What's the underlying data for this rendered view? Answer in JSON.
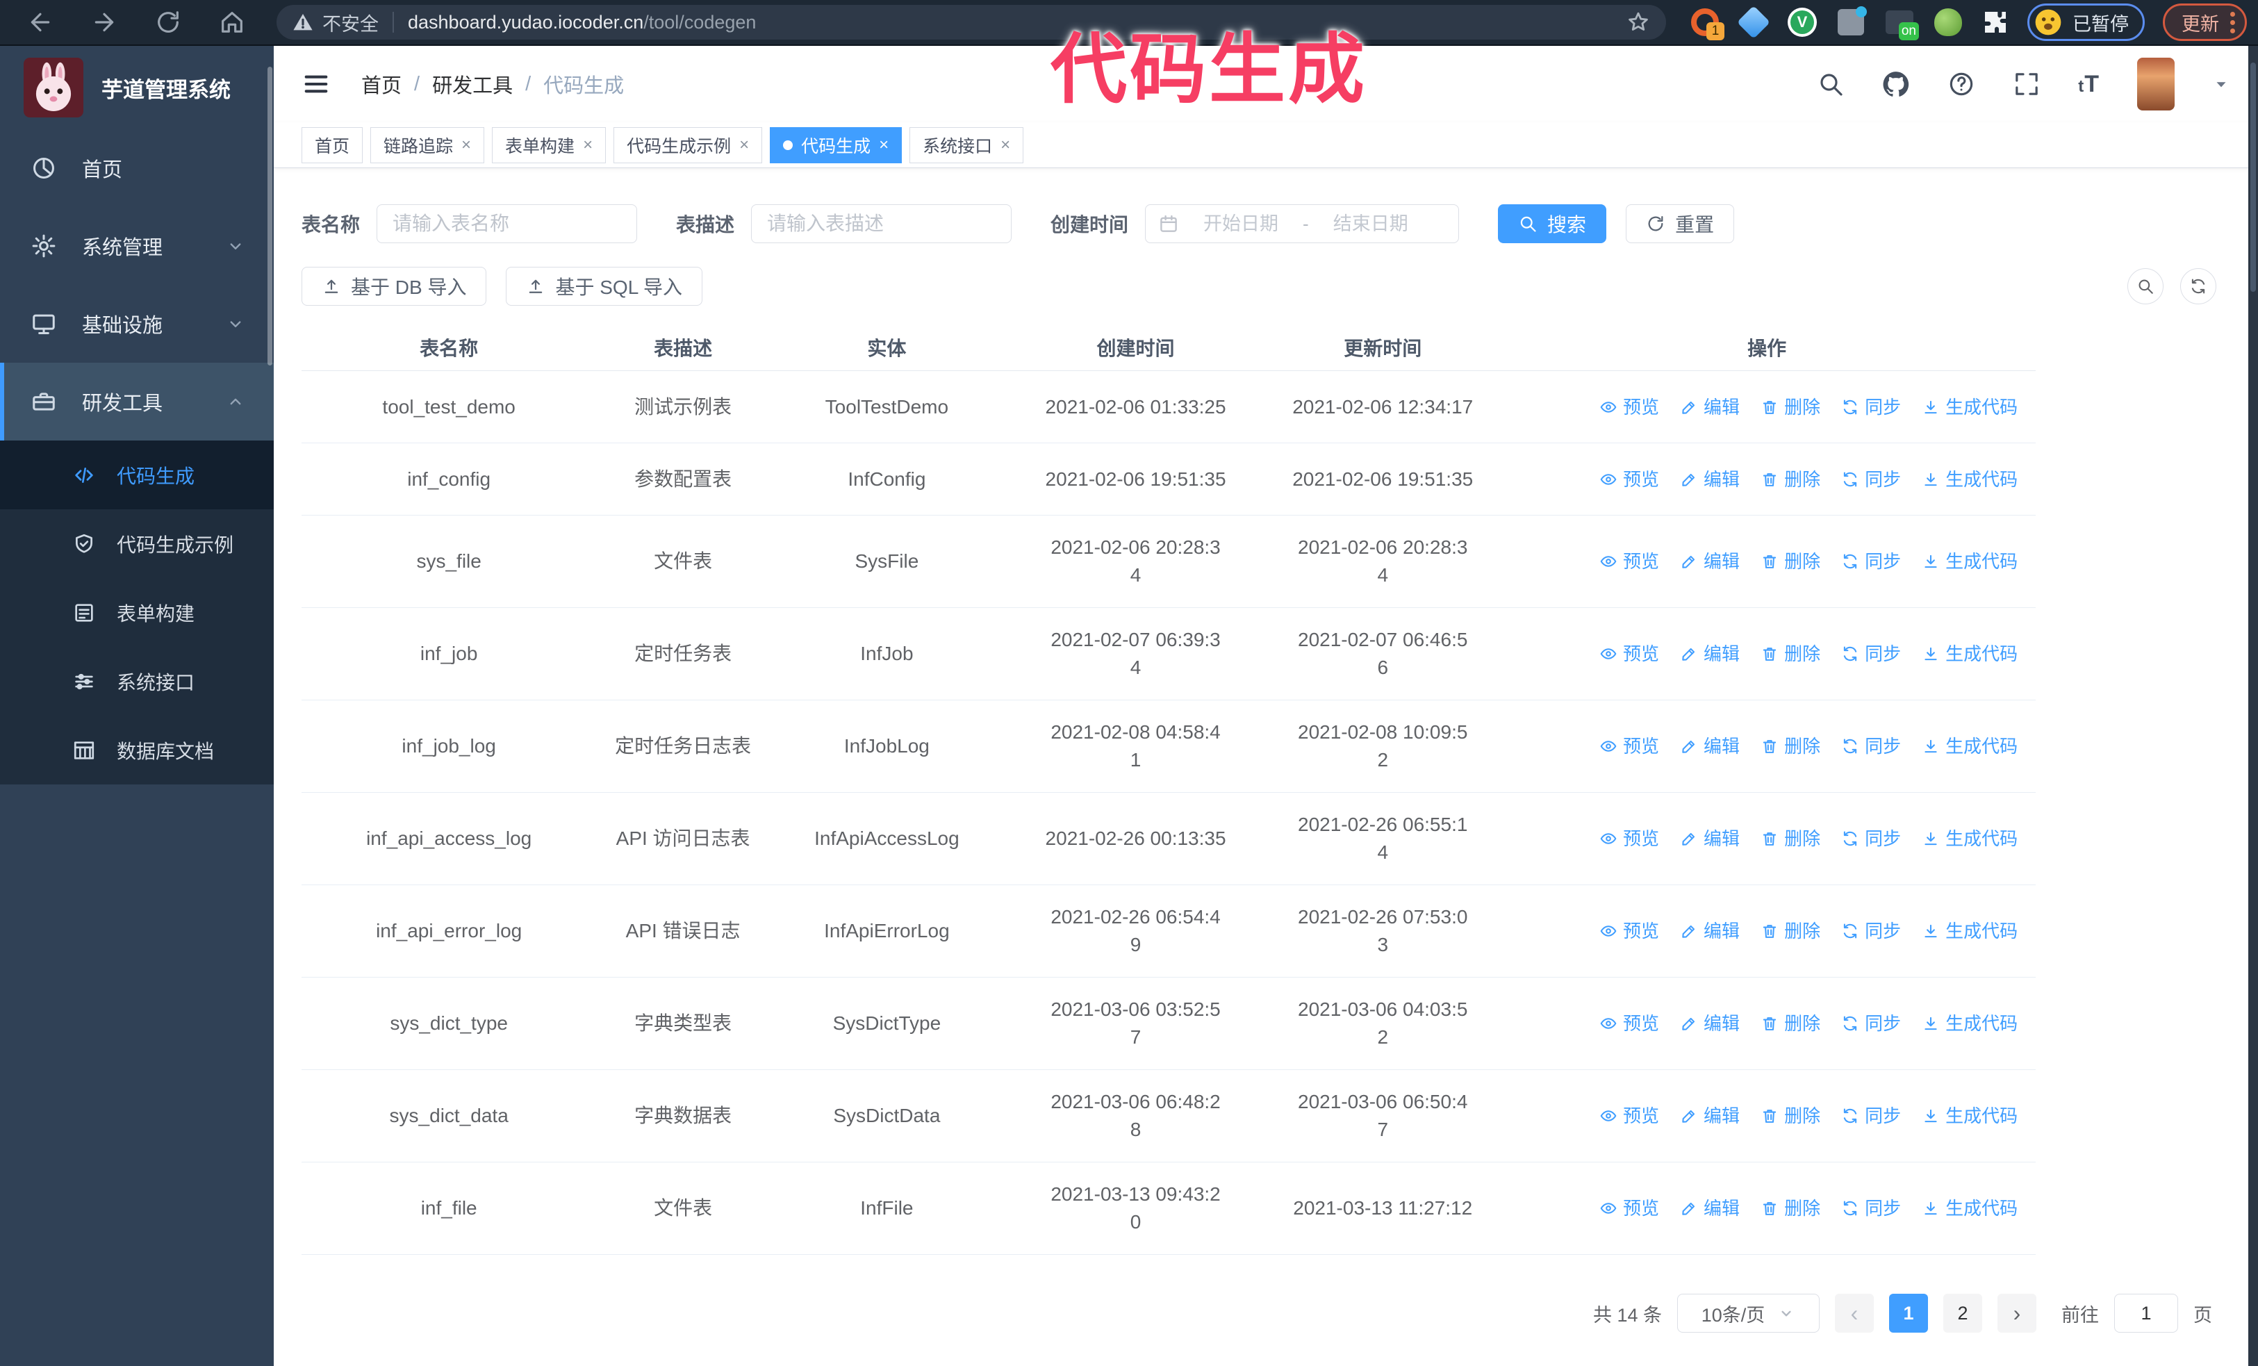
{
  "browser": {
    "security_label": "不安全",
    "url_host": "dashboard.yudao.iocoder.cn",
    "url_path": "/tool/codegen",
    "extension_badge": "1",
    "extension_on_badge": "on",
    "extension_v_label": "V",
    "paused_label": "已暂停",
    "update_label": "更新"
  },
  "annotation": {
    "text": "代码生成",
    "color": "#f63e63"
  },
  "sidebar": {
    "logo_title": "芋道管理系统",
    "items": [
      {
        "label": "首页",
        "icon": "dashboard-icon",
        "chevron": null,
        "open": false
      },
      {
        "label": "系统管理",
        "icon": "gear-icon",
        "chevron": "down",
        "open": false
      },
      {
        "label": "基础设施",
        "icon": "monitor-icon",
        "chevron": "down",
        "open": false
      },
      {
        "label": "研发工具",
        "icon": "toolbox-icon",
        "chevron": "up",
        "open": true
      }
    ],
    "subitems": [
      {
        "label": "代码生成",
        "icon": "code-icon",
        "active": true
      },
      {
        "label": "代码生成示例",
        "icon": "shield-check-icon",
        "active": false
      },
      {
        "label": "表单构建",
        "icon": "form-icon",
        "active": false
      },
      {
        "label": "系统接口",
        "icon": "sliders-icon",
        "active": false
      },
      {
        "label": "数据库文档",
        "icon": "table-grid-icon",
        "active": false
      }
    ]
  },
  "header": {
    "breadcrumb": [
      "首页",
      "研发工具",
      "代码生成"
    ]
  },
  "tabs": [
    {
      "label": "首页",
      "closable": false,
      "active": false
    },
    {
      "label": "链路追踪",
      "closable": true,
      "active": false
    },
    {
      "label": "表单构建",
      "closable": true,
      "active": false
    },
    {
      "label": "代码生成示例",
      "closable": true,
      "active": false
    },
    {
      "label": "代码生成",
      "closable": true,
      "active": true
    },
    {
      "label": "系统接口",
      "closable": true,
      "active": false
    }
  ],
  "filters": {
    "table_name_label": "表名称",
    "table_name_placeholder": "请输入表名称",
    "table_desc_label": "表描述",
    "table_desc_placeholder": "请输入表描述",
    "create_time_label": "创建时间",
    "date_start_placeholder": "开始日期",
    "date_separator": "-",
    "date_end_placeholder": "结束日期",
    "search_label": "搜索",
    "reset_label": "重置"
  },
  "toolbar": {
    "db_import_label": "基于 DB 导入",
    "sql_import_label": "基于 SQL 导入"
  },
  "table": {
    "columns": [
      "表名称",
      "表描述",
      "实体",
      "创建时间",
      "更新时间",
      "操作"
    ],
    "row_actions": [
      {
        "label": "预览",
        "icon": "eye-icon"
      },
      {
        "label": "编辑",
        "icon": "edit-icon"
      },
      {
        "label": "删除",
        "icon": "trash-icon"
      },
      {
        "label": "同步",
        "icon": "sync-icon"
      },
      {
        "label": "生成代码",
        "icon": "download-icon"
      }
    ],
    "rows": [
      {
        "name": "tool_test_demo",
        "desc": "测试示例表",
        "entity": "ToolTestDemo",
        "created": "2021-02-06 01:33:25",
        "updated": "2021-02-06 12:34:17"
      },
      {
        "name": "inf_config",
        "desc": "参数配置表",
        "entity": "InfConfig",
        "created": "2021-02-06 19:51:35",
        "updated": "2021-02-06 19:51:35"
      },
      {
        "name": "sys_file",
        "desc": "文件表",
        "entity": "SysFile",
        "created": "2021-02-06 20:28:3\n4",
        "updated": "2021-02-06 20:28:3\n4"
      },
      {
        "name": "inf_job",
        "desc": "定时任务表",
        "entity": "InfJob",
        "created": "2021-02-07 06:39:3\n4",
        "updated": "2021-02-07 06:46:5\n6"
      },
      {
        "name": "inf_job_log",
        "desc": "定时任务日志表",
        "entity": "InfJobLog",
        "created": "2021-02-08 04:58:4\n1",
        "updated": "2021-02-08 10:09:5\n2"
      },
      {
        "name": "inf_api_access_log",
        "desc": "API 访问日志表",
        "entity": "InfApiAccessLog",
        "created": "2021-02-26 00:13:35",
        "updated": "2021-02-26 06:55:1\n4"
      },
      {
        "name": "inf_api_error_log",
        "desc": "API 错误日志",
        "entity": "InfApiErrorLog",
        "created": "2021-02-26 06:54:4\n9",
        "updated": "2021-02-26 07:53:0\n3"
      },
      {
        "name": "sys_dict_type",
        "desc": "字典类型表",
        "entity": "SysDictType",
        "created": "2021-03-06 03:52:5\n7",
        "updated": "2021-03-06 04:03:5\n2"
      },
      {
        "name": "sys_dict_data",
        "desc": "字典数据表",
        "entity": "SysDictData",
        "created": "2021-03-06 06:48:2\n8",
        "updated": "2021-03-06 06:50:4\n7"
      },
      {
        "name": "inf_file",
        "desc": "文件表",
        "entity": "InfFile",
        "created": "2021-03-13 09:43:2\n0",
        "updated": "2021-03-13 11:27:12"
      }
    ]
  },
  "pagination": {
    "total_label": "共 14 条",
    "page_size_label": "10条/页",
    "pages": [
      "1",
      "2"
    ],
    "active_page": "1",
    "prev_label": "‹",
    "next_label": "›",
    "goto_label": "前往",
    "goto_value": "1",
    "goto_suffix": "页"
  }
}
